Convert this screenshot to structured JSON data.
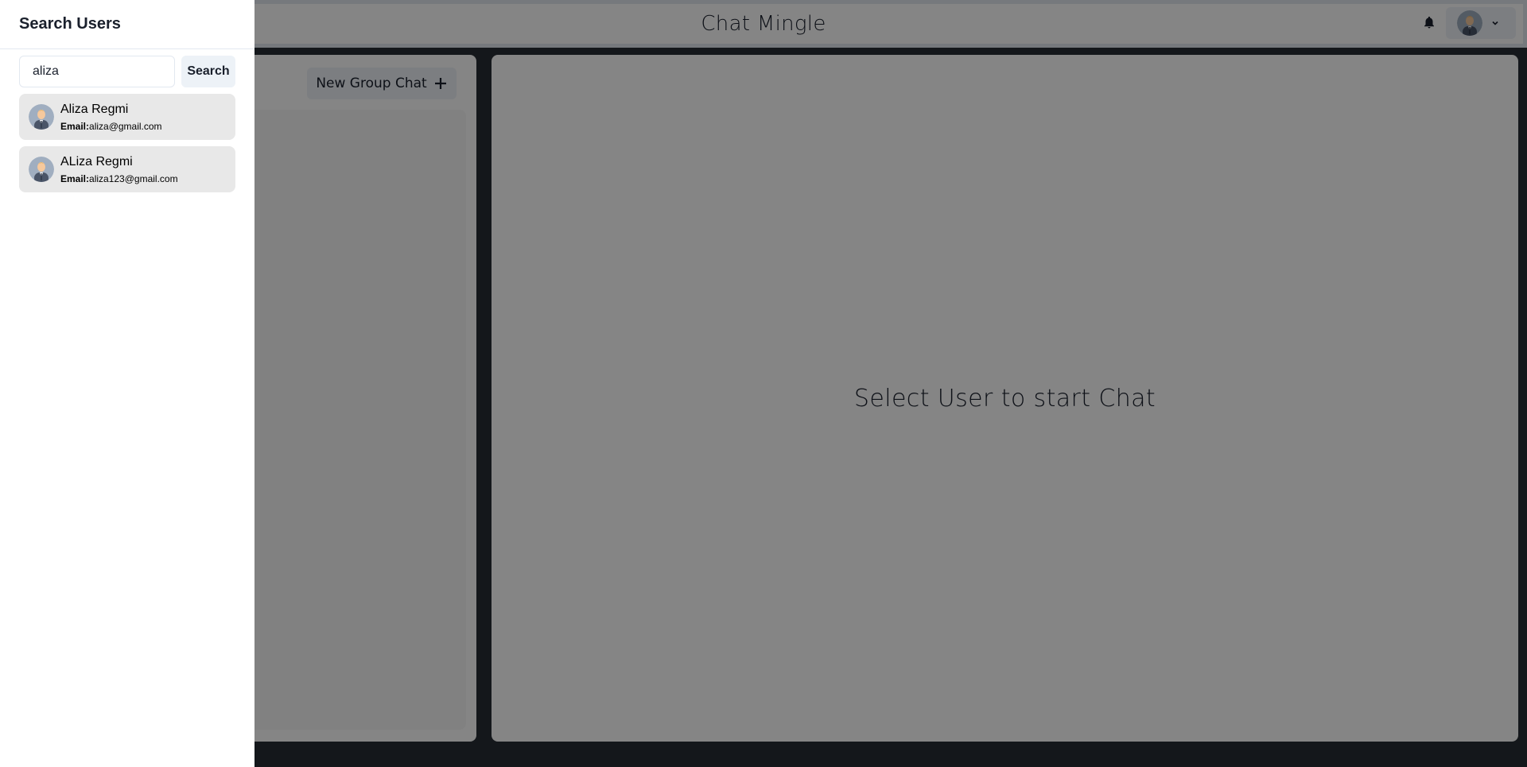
{
  "app": {
    "title": "Chat Mingle"
  },
  "header": {
    "notification_icon": "bell-icon",
    "profile_icon": "avatar-icon",
    "dropdown_icon": "chevron-down-icon"
  },
  "my_chats": {
    "new_group_label": "New Group Chat",
    "new_group_icon": "plus-icon"
  },
  "chat_box": {
    "empty_text": "Select User to start Chat"
  },
  "drawer": {
    "title": "Search Users",
    "search": {
      "value": "aliza",
      "placeholder": "",
      "button_label": "Search"
    },
    "results": [
      {
        "name": "Aliza Regmi",
        "email_label": "Email:",
        "email": "aliza@gmail.com"
      },
      {
        "name": "ALiza Regmi",
        "email_label": "Email:",
        "email": "aliza123@gmail.com"
      }
    ]
  },
  "colors": {
    "page_bg": "#282c34",
    "overlay": "rgba(0,0,0,0.48)",
    "button_bg": "#edf2f7",
    "result_bg": "#e8e8e8"
  }
}
